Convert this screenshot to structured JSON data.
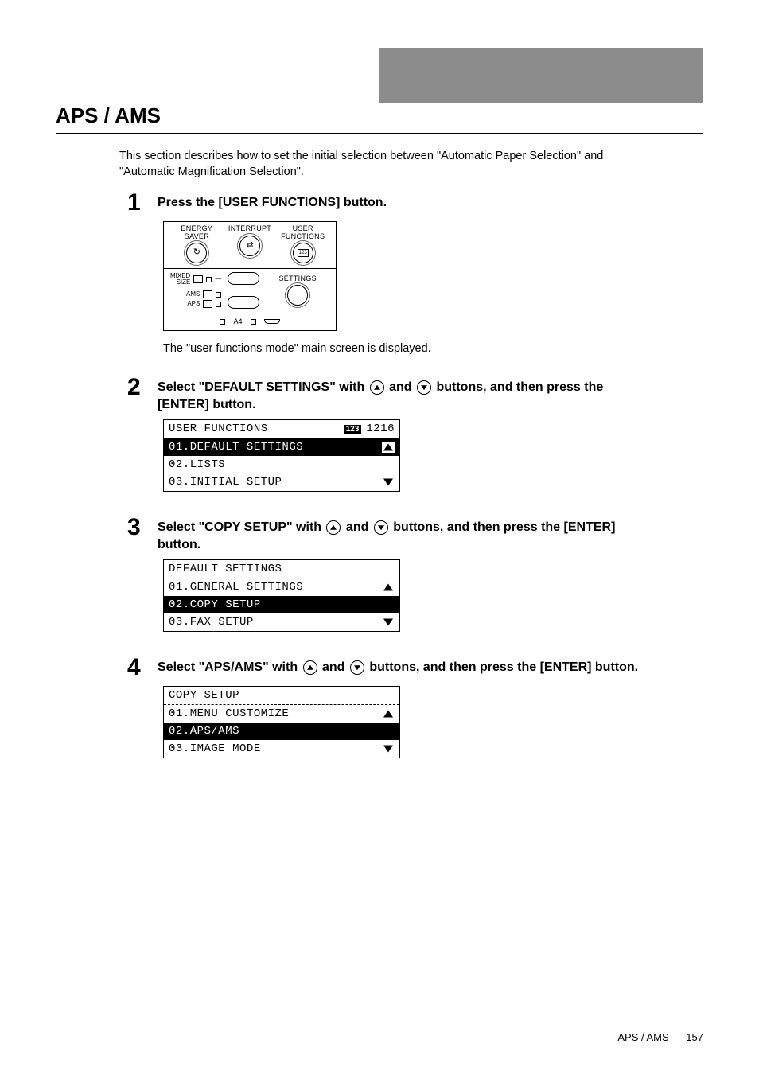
{
  "header": {
    "title": "APS / AMS"
  },
  "intro": "This section describes how to set the initial selection between \"Automatic Paper Selection\" and \"Automatic Magnification Selection\".",
  "steps": {
    "s1": {
      "num": "1",
      "text": "Press the [USER FUNCTIONS] button.",
      "note": "The \"user functions mode\" main screen is displayed."
    },
    "s2": {
      "num": "2",
      "text_a": "Select \"DEFAULT SETTINGS\" with ",
      "text_b": " and ",
      "text_c": " buttons, and then press the [ENTER] button."
    },
    "s3": {
      "num": "3",
      "text_a": "Select \"COPY SETUP\" with ",
      "text_b": " and ",
      "text_c": " buttons, and then press the [ENTER] button."
    },
    "s4": {
      "num": "4",
      "text_a": "Select \"APS/AMS\" with ",
      "text_b": " and ",
      "text_c": " buttons, and then press the [ENTER] button."
    }
  },
  "panel": {
    "labels": {
      "energy_saver": "ENERGY\nSAVER",
      "interrupt": "INTERRUPT",
      "user_functions": "USER\nFUNCTIONS",
      "mixed_size": "MIXED\nSIZE",
      "ams": "AMS",
      "aps": "APS",
      "settings": "SETTINGS",
      "a4": "A4"
    }
  },
  "lcd1": {
    "title": "USER FUNCTIONS",
    "clock": "1216",
    "row1": "01.DEFAULT SETTINGS",
    "row2": "02.LISTS",
    "row3": "03.INITIAL SETUP"
  },
  "lcd2": {
    "title": "DEFAULT SETTINGS",
    "row1": "01.GENERAL SETTINGS",
    "row2": "02.COPY SETUP",
    "row3": "03.FAX SETUP"
  },
  "lcd3": {
    "title": "COPY SETUP",
    "row1": "01.MENU CUSTOMIZE",
    "row2": "02.APS/AMS",
    "row3": "03.IMAGE MODE"
  },
  "footer": {
    "label": "APS / AMS",
    "page": "157"
  }
}
